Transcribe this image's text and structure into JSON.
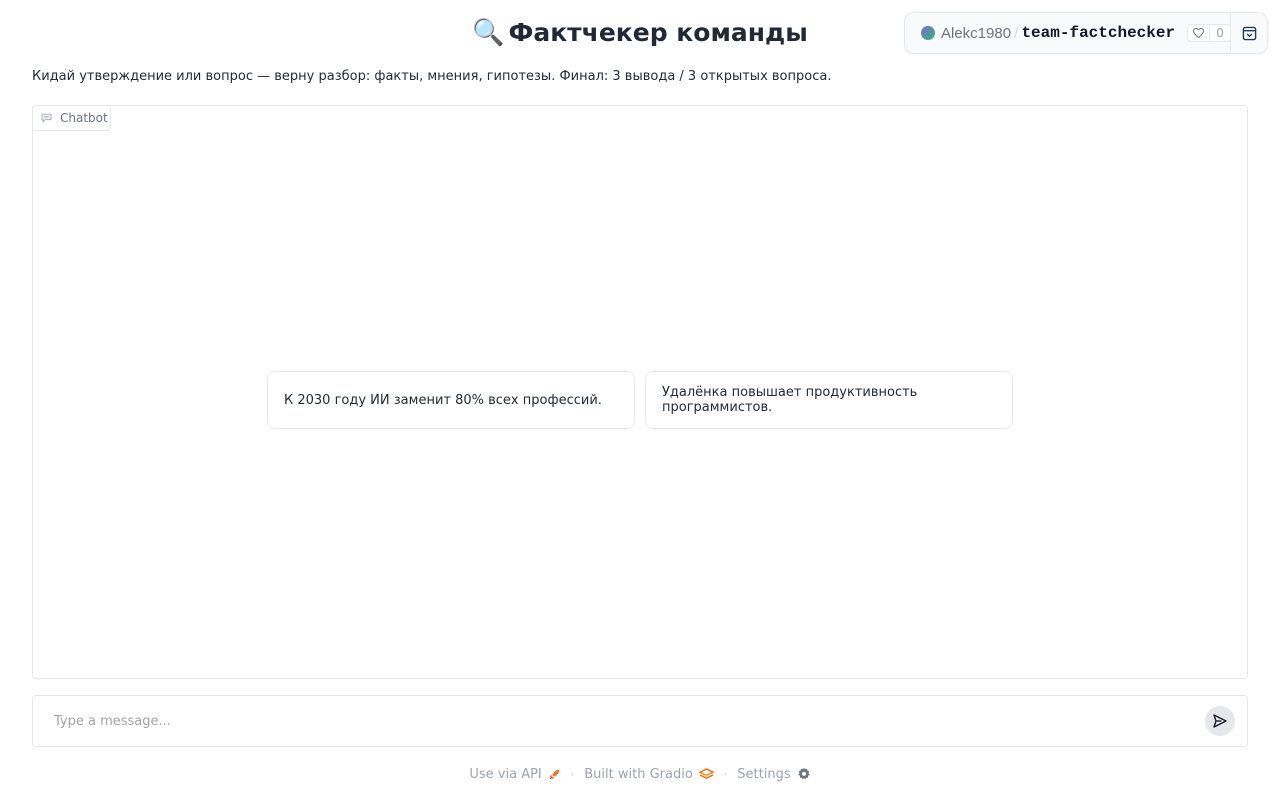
{
  "header": {
    "title_emoji": "🔍",
    "title": "Фактчекер команды"
  },
  "space": {
    "owner": "Alekc1980",
    "separator": "/",
    "name": "team-factchecker",
    "likes": "0",
    "icons": {
      "like": "heart-icon",
      "collapse": "collapse-icon"
    }
  },
  "description": "Кидай утверждение или вопрос — верну разбор: факты, мнения, гипотезы. Финал: 3 вывода / 3 открытых вопроса.",
  "chatbot": {
    "label": "Chatbot",
    "label_icon": "chat-icon",
    "examples": [
      "К 2030 году ИИ заменит 80% всех профессий.",
      "Удалёнка повышает продуктивность программистов."
    ]
  },
  "input": {
    "placeholder": "Type a message...",
    "value": "",
    "send_icon": "send-icon"
  },
  "footer": {
    "api_label": "Use via API",
    "built_label": "Built with Gradio",
    "settings_label": "Settings",
    "separator": "·",
    "icons": {
      "api": "rocket-icon",
      "gradio": "gradio-logo-icon",
      "settings": "gear-icon"
    }
  },
  "colors": {
    "accent": "#f97316",
    "border": "#e5e7eb",
    "text": "#1f2937",
    "muted": "#9ca3af"
  }
}
